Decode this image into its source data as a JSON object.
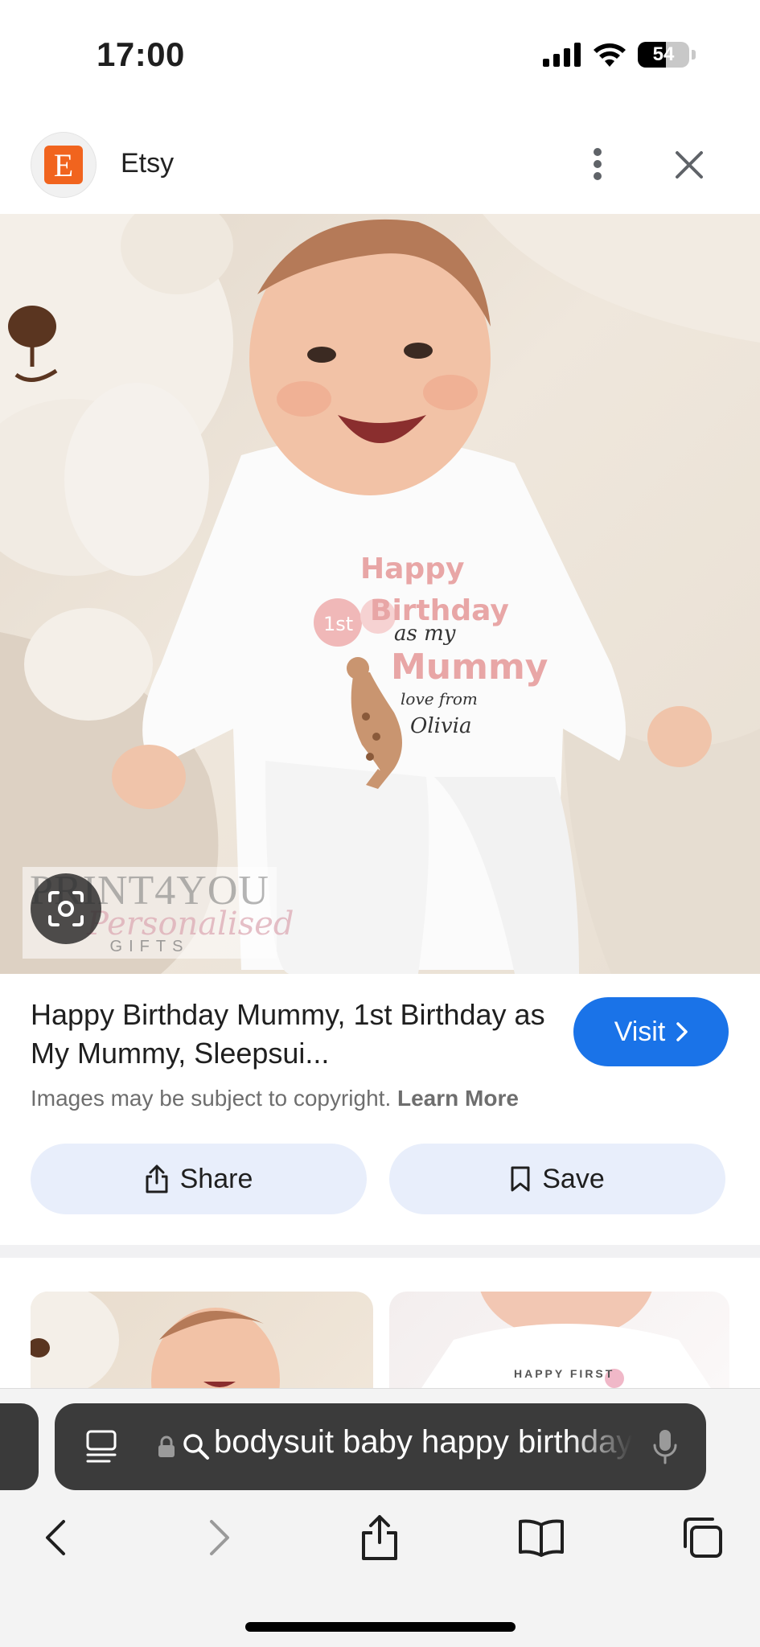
{
  "status_bar": {
    "time": "17:00",
    "battery_level": "54",
    "battery_fraction": 0.54,
    "icons": [
      "cellular-signal-icon",
      "wifi-icon",
      "battery-icon"
    ]
  },
  "header": {
    "favicon_letter": "E",
    "favicon_color": "#f1641e",
    "site_name": "Etsy",
    "icons": [
      "more-vertical-icon",
      "close-icon"
    ]
  },
  "main_image": {
    "description_icon": "product-photo",
    "watermark": {
      "line1": "PRINT4YOU",
      "line2": "Personalised",
      "line3": "GIFTS"
    }
  },
  "result": {
    "title": "Happy Birthday Mummy, 1st Birthday as My Mummy, Sleepsui...",
    "visit_label": "Visit",
    "copyright_text": "Images may be subject to copyright.",
    "learn_more": "Learn More",
    "share_label": "Share",
    "save_label": "Save"
  },
  "related": {
    "thumb_right_caption": "HAPPY FIRST"
  },
  "address_bar": {
    "query": "bodysuit baby happy birthday"
  },
  "colors": {
    "accent": "#1a73e8",
    "button_bg": "#e8eefb",
    "address_bar_bg": "#3b3b3b",
    "brand": "#f1641e"
  }
}
